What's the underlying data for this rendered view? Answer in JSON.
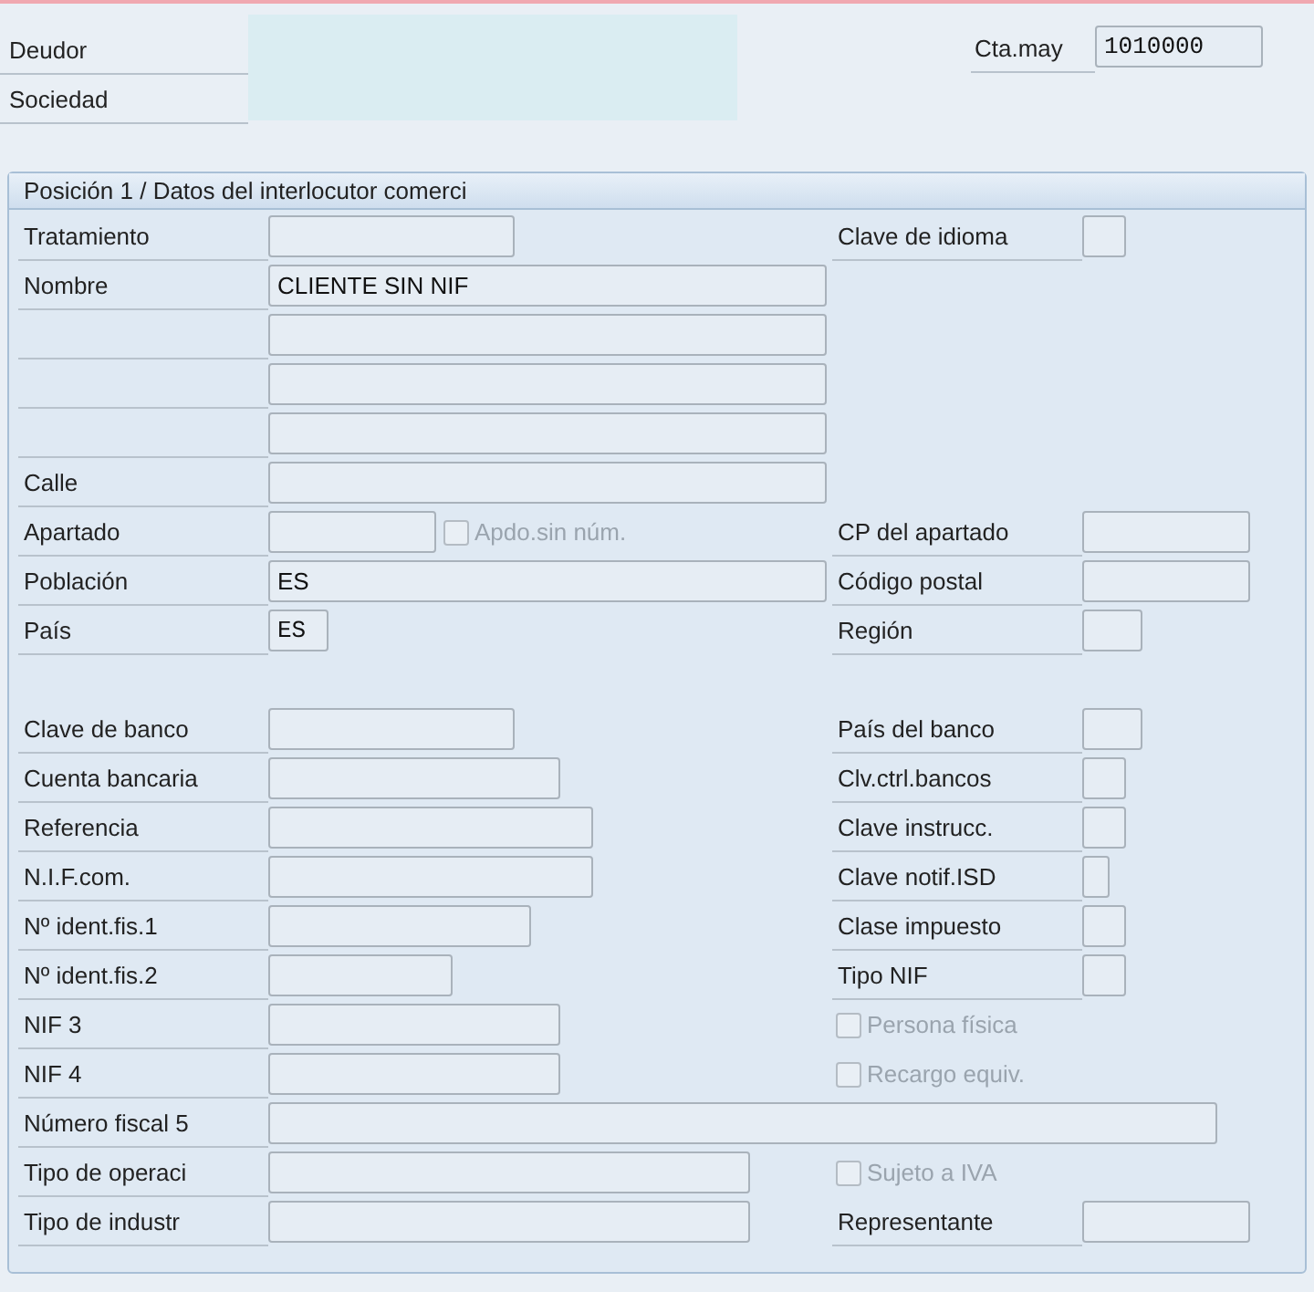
{
  "header": {
    "fields": [
      {
        "label": "Deudor"
      },
      {
        "label": "Sociedad"
      }
    ],
    "gl_account": {
      "label": "Cta.may",
      "value": "1010000"
    }
  },
  "panel": {
    "title": "Posición 1 / Datos del interlocutor comerci",
    "rows": [
      {
        "left": {
          "label": "Tratamiento"
        },
        "right": {
          "kind": "field",
          "label": "Clave de idioma"
        }
      },
      {
        "left": {
          "label": "Nombre",
          "value": "CLIENTE SIN NIF"
        }
      },
      {
        "left": {}
      },
      {
        "left": {}
      },
      {
        "left": {}
      },
      {
        "left": {
          "label": "Calle"
        }
      },
      {
        "left": {
          "label": "Apartado"
        },
        "extra": {
          "label": "Apdo.sin núm.",
          "checked": false,
          "disabled": true
        },
        "right": {
          "kind": "field",
          "label": "CP del apartado"
        }
      },
      {
        "left": {
          "label": "Población",
          "value": "ES"
        },
        "right": {
          "kind": "field",
          "label": "Código postal"
        }
      },
      {
        "left": {
          "label": "País",
          "value": "ES",
          "mono": true
        },
        "right": {
          "kind": "field",
          "label": "Región"
        }
      },
      {
        "kind": "blank"
      },
      {
        "left": {
          "label": "Clave de banco"
        },
        "right": {
          "kind": "field",
          "label": "País del banco"
        }
      },
      {
        "left": {
          "label": "Cuenta bancaria"
        },
        "right": {
          "kind": "field",
          "label": "Clv.ctrl.bancos"
        }
      },
      {
        "left": {
          "label": "Referencia"
        },
        "right": {
          "kind": "field",
          "label": "Clave instrucc."
        }
      },
      {
        "left": {
          "label": "N.I.F.com."
        },
        "right": {
          "kind": "field",
          "label": "Clave notif.ISD"
        }
      },
      {
        "left": {
          "label": "Nº ident.fis.1"
        },
        "right": {
          "kind": "field",
          "label": "Clase impuesto"
        }
      },
      {
        "left": {
          "label": "Nº ident.fis.2"
        },
        "right": {
          "kind": "field",
          "label": "Tipo NIF"
        }
      },
      {
        "left": {
          "label": "NIF 3"
        },
        "right": {
          "kind": "checkbox",
          "label": "Persona física",
          "checked": false,
          "disabled": true
        }
      },
      {
        "left": {
          "label": "NIF 4"
        },
        "right": {
          "kind": "checkbox",
          "label": "Recargo equiv.",
          "checked": false,
          "disabled": true
        }
      },
      {
        "left": {
          "label": "Número fiscal 5"
        }
      },
      {
        "left": {
          "label": "Tipo de operaci"
        },
        "right": {
          "kind": "checkbox",
          "label": "Sujeto a IVA",
          "checked": false,
          "disabled": true
        }
      },
      {
        "left": {
          "label": "Tipo de industr"
        },
        "right": {
          "kind": "field",
          "label": "Representante"
        }
      }
    ]
  }
}
